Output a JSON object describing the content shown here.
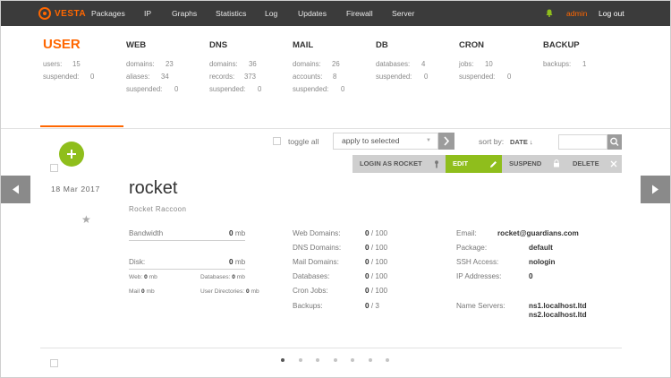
{
  "topbar": {
    "logo_text": "VESTA",
    "nav": [
      "Packages",
      "IP",
      "Graphs",
      "Statistics",
      "Log",
      "Updates",
      "Firewall",
      "Server"
    ],
    "user": "admin",
    "logout": "Log out"
  },
  "stats": {
    "user": {
      "title": "USER",
      "lines": [
        {
          "label": "users:",
          "value": "15"
        },
        {
          "label": "suspended:",
          "value": "0"
        }
      ]
    },
    "web": {
      "title": "WEB",
      "lines": [
        {
          "label": "domains:",
          "value": "23"
        },
        {
          "label": "aliases:",
          "value": "34"
        },
        {
          "label": "suspended:",
          "value": "0"
        }
      ]
    },
    "dns": {
      "title": "DNS",
      "lines": [
        {
          "label": "domains:",
          "value": "36"
        },
        {
          "label": "records:",
          "value": "373"
        },
        {
          "label": "suspended:",
          "value": "0"
        }
      ]
    },
    "mail": {
      "title": "MAIL",
      "lines": [
        {
          "label": "domains:",
          "value": "26"
        },
        {
          "label": "accounts:",
          "value": "8"
        },
        {
          "label": "suspended:",
          "value": "0"
        }
      ]
    },
    "db": {
      "title": "DB",
      "lines": [
        {
          "label": "databases:",
          "value": "4"
        },
        {
          "label": "suspended:",
          "value": "0"
        }
      ]
    },
    "cron": {
      "title": "CRON",
      "lines": [
        {
          "label": "jobs:",
          "value": "10"
        },
        {
          "label": "suspended:",
          "value": "0"
        }
      ]
    },
    "backup": {
      "title": "BACKUP",
      "lines": [
        {
          "label": "backups:",
          "value": "1"
        }
      ]
    }
  },
  "toolbar": {
    "toggle_all": "toggle all",
    "apply_select": "apply to selected",
    "sort_label": "sort by:",
    "sort_value": "DATE ↓",
    "search_placeholder": ""
  },
  "actions": {
    "login_as": "LOGIN AS ROCKET",
    "edit": "EDIT",
    "suspend": "SUSPEND",
    "delete": "DELETE"
  },
  "user": {
    "date": "18 Mar 2017",
    "name": "rocket",
    "full_name": "Rocket Raccoon",
    "bandwidth_label": "Bandwidth",
    "bandwidth_value": "0",
    "disk_label": "Disk:",
    "disk_value": "0",
    "unit": "mb",
    "disk_web_label": "Web:",
    "disk_web_value": "0",
    "disk_db_label": "Databases:",
    "disk_db_value": "0",
    "disk_mail_label": "Mail",
    "disk_mail_value": "0",
    "disk_userdir_label": "User Directories:",
    "disk_userdir_value": "0",
    "limits": [
      {
        "label": "Web Domains:",
        "used": "0",
        "max": " / 100"
      },
      {
        "label": "DNS Domains:",
        "used": "0",
        "max": " / 100"
      },
      {
        "label": "Mail Domains:",
        "used": "0",
        "max": " / 100"
      },
      {
        "label": "Databases:",
        "used": "0",
        "max": " / 100"
      },
      {
        "label": "Cron Jobs:",
        "used": "0",
        "max": " / 100"
      },
      {
        "label": "Backups:",
        "used": "0",
        "max": " / 3"
      }
    ],
    "info": {
      "email_label": "Email:",
      "email": "rocket@guardians.com",
      "package_label": "Package:",
      "package": "default",
      "ssh_label": "SSH Access:",
      "ssh": "nologin",
      "ip_label": "IP Addresses:",
      "ip": "0",
      "ns_label": "Name Servers:",
      "ns1": "ns1.localhost.ltd",
      "ns2": "ns2.localhost.ltd"
    }
  },
  "pagination": {
    "count": 7,
    "active": 0
  },
  "colors": {
    "accent": "#ff6701",
    "green": "#8fbe1c",
    "topbar": "#3b3b3b"
  }
}
